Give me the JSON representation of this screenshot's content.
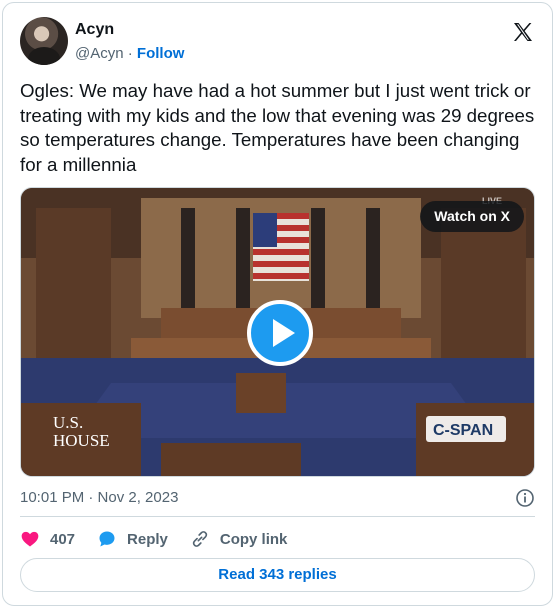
{
  "author": {
    "name": "Acyn",
    "handle": "@Acyn",
    "separator": "·",
    "follow_label": "Follow"
  },
  "tweet": {
    "text": "Ogles: We may have had a hot summer but I just went trick or treating with my kids and the low that evening was 29 degrees so temperatures change. Temperatures have been changing for a millennia",
    "timestamp": "10:01 PM · Nov 2, 2023"
  },
  "media": {
    "watch_label": "Watch on X",
    "live_label": "LIVE",
    "overlay_left": [
      "U.S.",
      "HOUSE"
    ],
    "overlay_right": "C-SPAN"
  },
  "actions": {
    "likes": "407",
    "reply_label": "Reply",
    "copy_label": "Copy link"
  },
  "read_replies_label": "Read 343 replies",
  "colors": {
    "accent": "#1d9bf0",
    "link": "#006fd6",
    "like": "#f91880",
    "muted": "#536471"
  },
  "icons": [
    "x-logo-icon",
    "play-icon",
    "info-icon",
    "heart-icon",
    "reply-bubble-icon",
    "link-icon"
  ]
}
